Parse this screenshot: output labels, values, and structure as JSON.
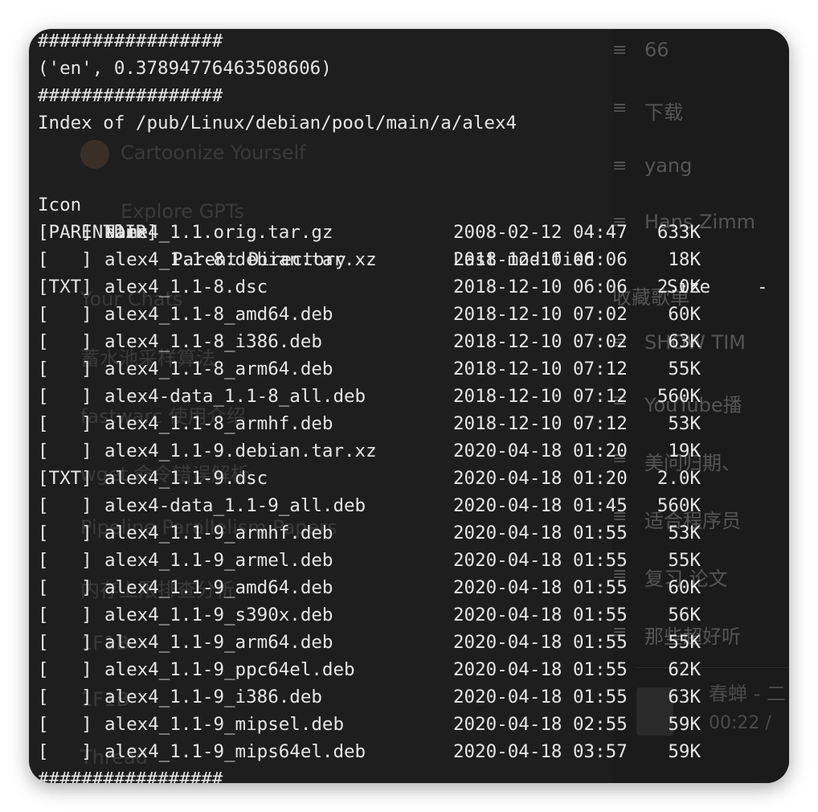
{
  "terminal": {
    "separator": "#################",
    "lang_result": "('en', 0.37894776463508606)",
    "index_title": "Index of /pub/Linux/debian/pool/main/a/alex4",
    "headers": {
      "icon": "Icon",
      "name": "Name",
      "modified": "Last modified",
      "size": "Size"
    },
    "parent": {
      "icon": "[PARENTDIR]",
      "name": "Parent Directory",
      "size": "-"
    },
    "rows": [
      {
        "icon": "[   ]",
        "name": "alex4_1.1.orig.tar.gz",
        "date": "2008-02-12 04:47",
        "size": "633K"
      },
      {
        "icon": "[   ]",
        "name": "alex4_1.1-8.debian.tar.xz",
        "date": "2018-12-10 06:06",
        "size": "18K"
      },
      {
        "icon": "[TXT]",
        "name": "alex4_1.1-8.dsc",
        "date": "2018-12-10 06:06",
        "size": "2.0K"
      },
      {
        "icon": "[   ]",
        "name": "alex4_1.1-8_amd64.deb",
        "date": "2018-12-10 07:02",
        "size": "60K"
      },
      {
        "icon": "[   ]",
        "name": "alex4_1.1-8_i386.deb",
        "date": "2018-12-10 07:02",
        "size": "63K"
      },
      {
        "icon": "[   ]",
        "name": "alex4_1.1-8_arm64.deb",
        "date": "2018-12-10 07:12",
        "size": "55K"
      },
      {
        "icon": "[   ]",
        "name": "alex4-data_1.1-8_all.deb",
        "date": "2018-12-10 07:12",
        "size": "560K"
      },
      {
        "icon": "[   ]",
        "name": "alex4_1.1-8_armhf.deb",
        "date": "2018-12-10 07:12",
        "size": "53K"
      },
      {
        "icon": "[   ]",
        "name": "alex4_1.1-9.debian.tar.xz",
        "date": "2020-04-18 01:20",
        "size": "19K"
      },
      {
        "icon": "[TXT]",
        "name": "alex4_1.1-9.dsc",
        "date": "2020-04-18 01:20",
        "size": "2.0K"
      },
      {
        "icon": "[   ]",
        "name": "alex4-data_1.1-9_all.deb",
        "date": "2020-04-18 01:45",
        "size": "560K"
      },
      {
        "icon": "[   ]",
        "name": "alex4_1.1-9_armhf.deb",
        "date": "2020-04-18 01:55",
        "size": "53K"
      },
      {
        "icon": "[   ]",
        "name": "alex4_1.1-9_armel.deb",
        "date": "2020-04-18 01:55",
        "size": "55K"
      },
      {
        "icon": "[   ]",
        "name": "alex4_1.1-9_amd64.deb",
        "date": "2020-04-18 01:55",
        "size": "60K"
      },
      {
        "icon": "[   ]",
        "name": "alex4_1.1-9_s390x.deb",
        "date": "2020-04-18 01:55",
        "size": "56K"
      },
      {
        "icon": "[   ]",
        "name": "alex4_1.1-9_arm64.deb",
        "date": "2020-04-18 01:55",
        "size": "55K"
      },
      {
        "icon": "[   ]",
        "name": "alex4_1.1-9_ppc64el.deb",
        "date": "2020-04-18 01:55",
        "size": "62K"
      },
      {
        "icon": "[   ]",
        "name": "alex4_1.1-9_i386.deb",
        "date": "2020-04-18 01:55",
        "size": "63K"
      },
      {
        "icon": "[   ]",
        "name": "alex4_1.1-9_mipsel.deb",
        "date": "2020-04-18 02:55",
        "size": "59K"
      },
      {
        "icon": "[   ]",
        "name": "alex4_1.1-9_mips64el.deb",
        "date": "2020-04-18 03:57",
        "size": "59K"
      }
    ]
  },
  "background_left": [
    "Cartoonize Yourself",
    "Explore GPTs",
    "Your Chats",
    "蓄水池采样算法",
    "fastwarc 使用介绍",
    "wget 命令错误解析",
    "Pipeline Parallelism Papers",
    "内存上限排查分析",
    "1F1B",
    "1F1B",
    "Thread"
  ],
  "background_right": {
    "playlists": [
      "66",
      "下载",
      "yang",
      "Hans Zimm",
      "收藏歌单",
      "SHOW TIM",
      "YouTube播",
      "美问归期、",
      "适合程序员",
      "复习 论文",
      "那些超好听"
    ],
    "player": {
      "track": "春蝉 - 二",
      "time": "00:22 /"
    }
  },
  "colors": {
    "terminal_bg": "#1e1e1e",
    "text": "#e6e6e6"
  }
}
